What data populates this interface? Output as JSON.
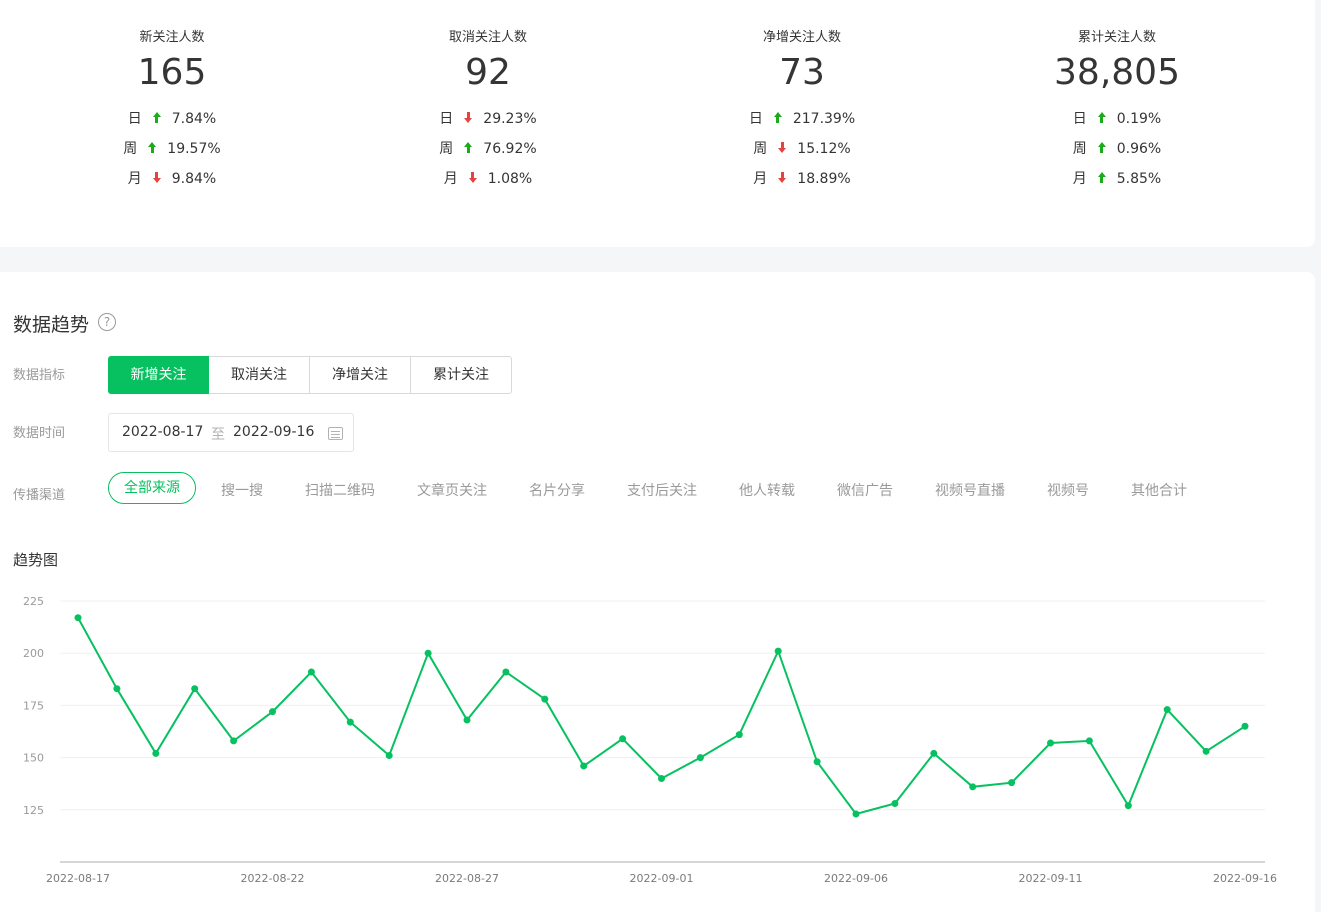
{
  "stats": [
    {
      "title": "新关注人数",
      "value": "165",
      "rows": [
        {
          "label": "日",
          "dir": "up",
          "pct": "7.84%"
        },
        {
          "label": "周",
          "dir": "up",
          "pct": "19.57%"
        },
        {
          "label": "月",
          "dir": "down",
          "pct": "9.84%"
        }
      ]
    },
    {
      "title": "取消关注人数",
      "value": "92",
      "rows": [
        {
          "label": "日",
          "dir": "down",
          "pct": "29.23%"
        },
        {
          "label": "周",
          "dir": "up",
          "pct": "76.92%"
        },
        {
          "label": "月",
          "dir": "down",
          "pct": "1.08%"
        }
      ]
    },
    {
      "title": "净增关注人数",
      "value": "73",
      "rows": [
        {
          "label": "日",
          "dir": "up",
          "pct": "217.39%"
        },
        {
          "label": "周",
          "dir": "down",
          "pct": "15.12%"
        },
        {
          "label": "月",
          "dir": "down",
          "pct": "18.89%"
        }
      ]
    },
    {
      "title": "累计关注人数",
      "value": "38,805",
      "rows": [
        {
          "label": "日",
          "dir": "up",
          "pct": "0.19%"
        },
        {
          "label": "周",
          "dir": "up",
          "pct": "0.96%"
        },
        {
          "label": "月",
          "dir": "up",
          "pct": "5.85%"
        }
      ]
    }
  ],
  "trend": {
    "title": "数据趋势",
    "help_glyph": "?",
    "metric_label": "数据指标",
    "metrics": [
      "新增关注",
      "取消关注",
      "净增关注",
      "累计关注"
    ],
    "active_metric": 0,
    "time_label": "数据时间",
    "date_start": "2022-08-17",
    "date_sep": "至",
    "date_end": "2022-09-16",
    "channel_label": "传播渠道",
    "channels": [
      "全部来源",
      "搜一搜",
      "扫描二维码",
      "文章页关注",
      "名片分享",
      "支付后关注",
      "他人转载",
      "微信广告",
      "视频号直播",
      "视频号",
      "其他合计"
    ],
    "active_channel": 0
  },
  "chart_title": "趋势图",
  "chart_data": {
    "type": "line",
    "x": [
      "2022-08-17",
      "2022-08-18",
      "2022-08-19",
      "2022-08-20",
      "2022-08-21",
      "2022-08-22",
      "2022-08-23",
      "2022-08-24",
      "2022-08-25",
      "2022-08-26",
      "2022-08-27",
      "2022-08-28",
      "2022-08-29",
      "2022-08-30",
      "2022-08-31",
      "2022-09-01",
      "2022-09-02",
      "2022-09-03",
      "2022-09-04",
      "2022-09-05",
      "2022-09-06",
      "2022-09-07",
      "2022-09-08",
      "2022-09-09",
      "2022-09-10",
      "2022-09-11",
      "2022-09-12",
      "2022-09-13",
      "2022-09-14",
      "2022-09-15",
      "2022-09-16"
    ],
    "series": [
      {
        "values": [
          217,
          183,
          152,
          183,
          158,
          172,
          191,
          167,
          151,
          200,
          168,
          191,
          178,
          146,
          159,
          140,
          150,
          161,
          201,
          148,
          123,
          128,
          152,
          136,
          138,
          157,
          158,
          127,
          173,
          153,
          165
        ]
      }
    ],
    "x_tick_labels": [
      "2022-08-17",
      "2022-08-22",
      "2022-08-27",
      "2022-09-01",
      "2022-09-06",
      "2022-09-11",
      "2022-09-16"
    ],
    "y_ticks": [
      125,
      150,
      175,
      200,
      225
    ],
    "ylim": [
      100,
      225
    ],
    "grid": true,
    "color": "#07c160"
  }
}
